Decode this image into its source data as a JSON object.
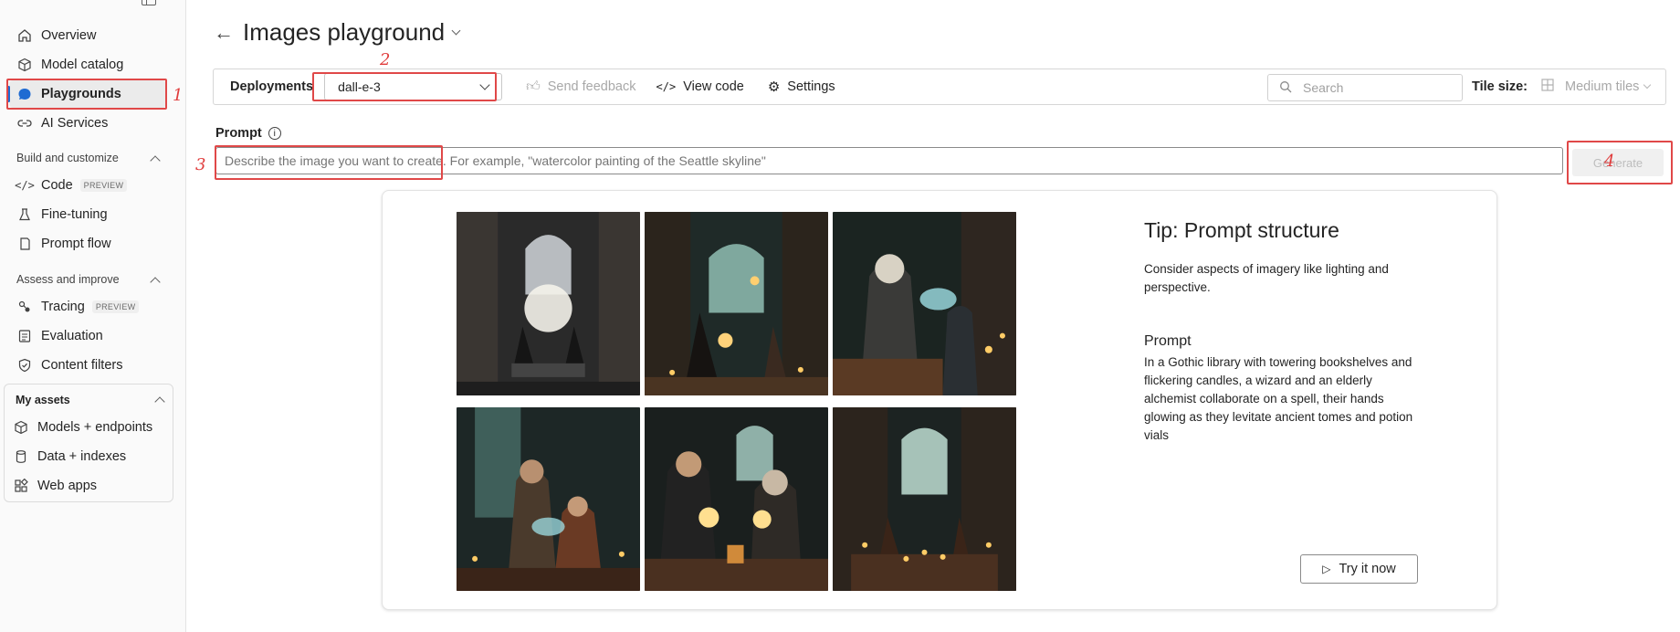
{
  "sidebar": {
    "top_items": [
      {
        "label": "Overview",
        "icon": "home-icon"
      },
      {
        "label": "Model catalog",
        "icon": "cube-icon"
      },
      {
        "label": "Playgrounds",
        "icon": "chat-icon",
        "active": true
      },
      {
        "label": "AI Services",
        "icon": "link-icon"
      }
    ],
    "sections": [
      {
        "title": "Build and customize",
        "items": [
          {
            "label": "Code",
            "badge": "PREVIEW",
            "icon": "code-icon"
          },
          {
            "label": "Fine-tuning",
            "icon": "flask-icon"
          },
          {
            "label": "Prompt flow",
            "icon": "flow-icon"
          }
        ]
      },
      {
        "title": "Assess and improve",
        "items": [
          {
            "label": "Tracing",
            "badge": "PREVIEW",
            "icon": "trace-icon"
          },
          {
            "label": "Evaluation",
            "icon": "evaluation-icon"
          },
          {
            "label": "Content filters",
            "icon": "shield-icon"
          }
        ]
      }
    ],
    "assets": {
      "title": "My assets",
      "items": [
        {
          "label": "Models + endpoints",
          "icon": "cube-icon"
        },
        {
          "label": "Data + indexes",
          "icon": "database-icon"
        },
        {
          "label": "Web apps",
          "icon": "apps-icon"
        }
      ]
    }
  },
  "header": {
    "title": "Images playground"
  },
  "toolbar": {
    "deployments_label": "Deployments",
    "deployment_value": "dall-e-3",
    "send_feedback": "Send feedback",
    "view_code": "View code",
    "settings": "Settings",
    "search_placeholder": "Search",
    "tile_size_label": "Tile size:",
    "tile_size_value": "Medium tiles"
  },
  "prompt": {
    "label": "Prompt",
    "placeholder": "Describe the image you want to create. For example, \"watercolor painting of the Seattle skyline\"",
    "generate_label": "Generate"
  },
  "tip": {
    "title": "Tip: Prompt structure",
    "description": "Consider aspects of imagery like lighting and perspective.",
    "prompt_heading": "Prompt",
    "prompt_text": "In a Gothic library with towering bookshelves and flickering candles, a wizard and an elderly alchemist collaborate on a spell, their hands glowing as they levitate ancient tomes and potion vials",
    "try_label": "Try it now"
  },
  "annotations": [
    "1",
    "2",
    "3",
    "4"
  ],
  "colors": {
    "accent": "#1f6bd2",
    "annotation_red": "#e04848"
  }
}
